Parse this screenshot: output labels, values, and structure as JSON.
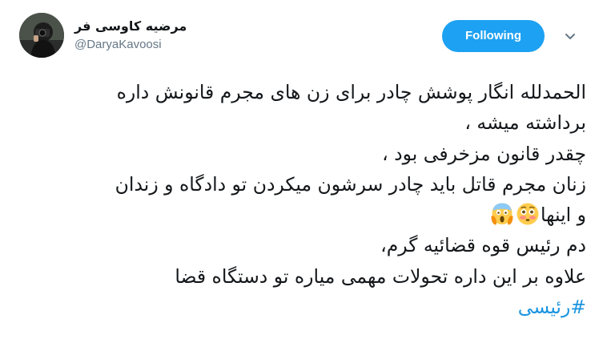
{
  "author": {
    "display_name": "مرضیه کاوسی فر",
    "handle": "@DaryaKavoosi"
  },
  "follow_button": {
    "label": "Following"
  },
  "tweet": {
    "lines": [
      "الحمدلله انگار پوشش چادر برای زن های مجرم قانونش داره",
      "برداشته میشه ،",
      "چقدر قانون مزخرفی بود ،",
      "زنان مجرم قاتل باید چادر سرشون میکردن تو دادگاه و زندان",
      "و اینها",
      "دم رئیس قوه قضائیه گرم،",
      "علاوه بر این داره تحولات مهمی میاره تو دستگاه قضا"
    ],
    "emojis": [
      "flushed-face",
      "face-screaming-in-fear"
    ],
    "hashtag": "#رئیسی"
  },
  "colors": {
    "accent": "#1da1f2",
    "hashtag": "#1b95e0",
    "secondary_text": "#657786"
  }
}
